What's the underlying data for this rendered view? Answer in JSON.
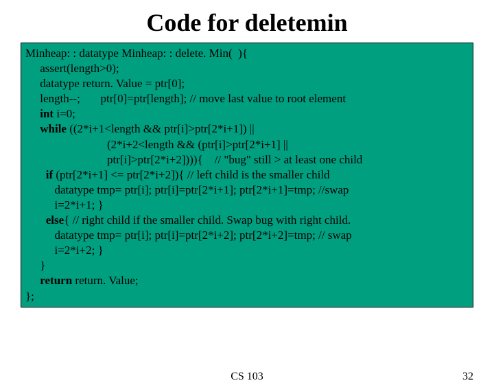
{
  "title": "Code for deletemin",
  "code": {
    "l1a": "Minheap: : datatype Minheap: : delete. Min(  ){",
    "l2a": "     assert(length>0);",
    "l3a": "     datatype return. Value = ptr[0];",
    "l4a": "     length--;       ptr[0]=ptr[length]; // move last value to root element",
    "l5_kw": "     int",
    "l5_rest": " i=0;",
    "l6_kw": "     while",
    "l6_rest": " ((2*i+1<length && ptr[i]>ptr[2*i+1]) ||",
    "l7": "                            (2*i+2<length && (ptr[i]>ptr[2*i+1] ||",
    "l8": "                            ptr[i]>ptr[2*i+2]))){    // \"bug\" still > at least one child",
    "l9_kw": "       if",
    "l9_rest": " (ptr[2*i+1] <= ptr[2*i+2]){ // left child is the smaller child",
    "l10": "          datatype tmp= ptr[i]; ptr[i]=ptr[2*i+1]; ptr[2*i+1]=tmp; //swap",
    "l11": "          i=2*i+1; }",
    "l12_kw": "       else",
    "l12_rest": "{ // right child if the smaller child. Swap bug with right child.",
    "l13": "          datatype tmp= ptr[i]; ptr[i]=ptr[2*i+2]; ptr[2*i+2]=tmp; // swap",
    "l14": "          i=2*i+2; }",
    "l15": "     }",
    "l16_kw": "     return",
    "l16_rest": " return. Value;",
    "l17": "};"
  },
  "footer": {
    "center": "CS 103",
    "page": "32"
  }
}
